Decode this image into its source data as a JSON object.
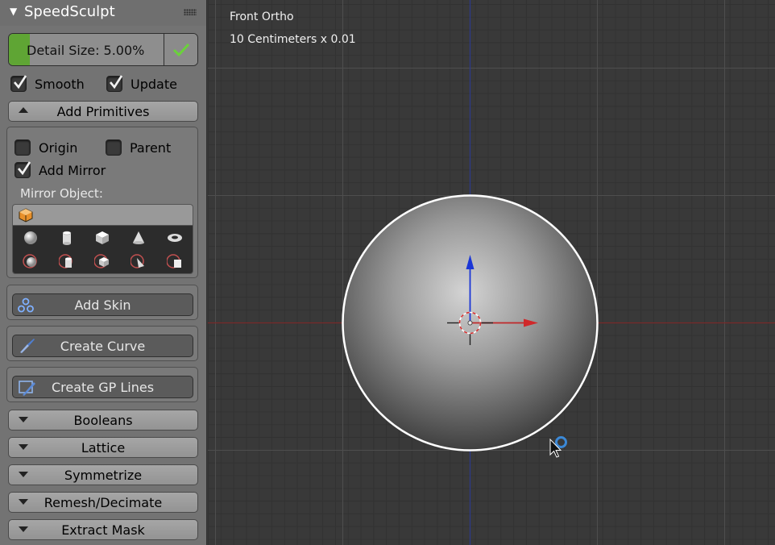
{
  "panel": {
    "title": "SpeedSculpt",
    "collapse_icon": "triangle-down-icon",
    "grip_icon": "drag-grip-icon",
    "detail_size": {
      "label": "Detail Size: 5.00%",
      "fill_fraction": 0.11,
      "confirm_icon": "checkmark-icon"
    },
    "options": {
      "smooth": {
        "label": "Smooth",
        "checked": true
      },
      "update": {
        "label": "Update",
        "checked": true
      }
    },
    "add_primitives": {
      "label": "Add Primitives",
      "expanded": true,
      "origin": {
        "label": "Origin",
        "checked": false
      },
      "parent": {
        "label": "Parent",
        "checked": false
      },
      "add_mirror": {
        "label": "Add Mirror",
        "checked": true
      },
      "mirror_object_label": "Mirror Object:",
      "mirror_object_icon": "cube-object-icon",
      "primitive_icons": [
        "sphere-icon",
        "cylinder-icon",
        "cube-icon",
        "cone-icon",
        "torus-icon",
        "sphere-mirror-icon",
        "cylinder-mirror-icon",
        "cube-mirror-icon",
        "cone-mirror-icon",
        "plane-mirror-icon"
      ]
    },
    "add_skin": {
      "label": "Add Skin",
      "icon": "skin-modifier-icon"
    },
    "create_curve": {
      "label": "Create Curve",
      "icon": "brush-icon"
    },
    "create_gp_lines": {
      "label": "Create GP Lines",
      "icon": "grease-pencil-icon"
    },
    "collapsed_sections": [
      {
        "label": "Booleans"
      },
      {
        "label": "Lattice"
      },
      {
        "label": "Symmetrize"
      },
      {
        "label": "Remesh/Decimate"
      },
      {
        "label": "Extract Mask"
      }
    ]
  },
  "viewport": {
    "view_name": "Front Ortho",
    "grid_scale": "10 Centimeters x 0.01",
    "colors": {
      "background": "#393939",
      "x_axis": "#c0282a",
      "z_axis": "#1b36d6",
      "selection_outline": "#ffffff",
      "cursor_ring": "#3b88d6"
    }
  }
}
